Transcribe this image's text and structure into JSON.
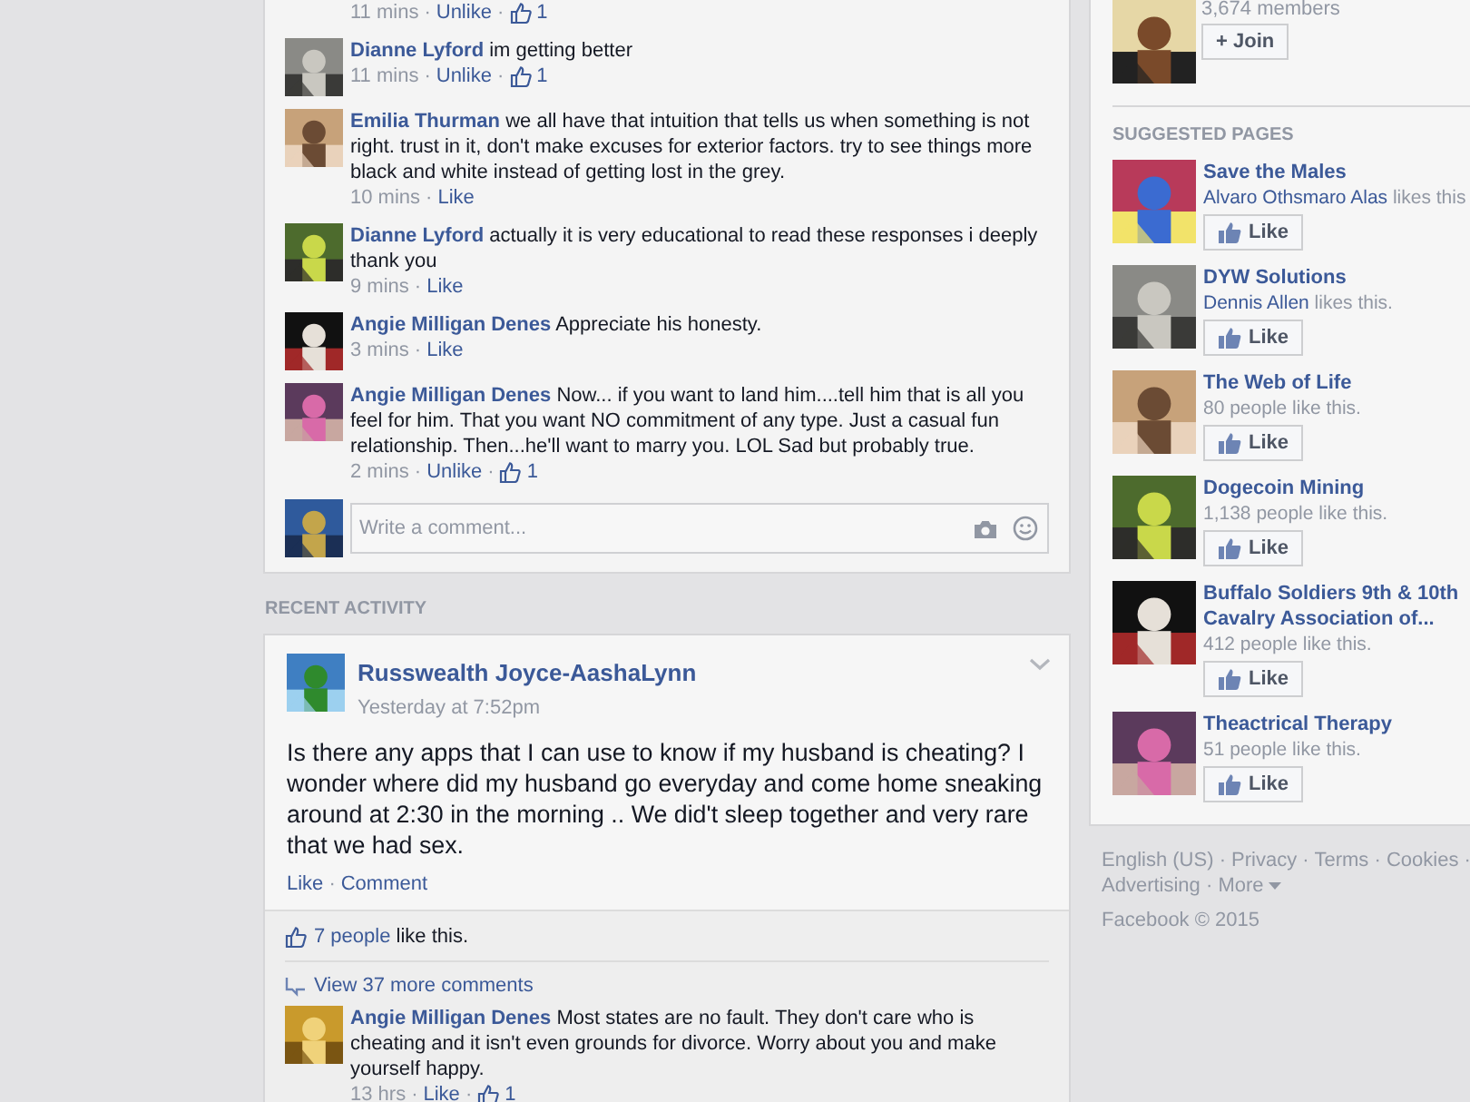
{
  "comment_thread": {
    "cut_meta": {
      "time": "11 mins",
      "action": "Unlike",
      "likes": "1"
    },
    "comments": [
      {
        "author": "Dianne Lyford",
        "text": "im getting better",
        "time": "11 mins",
        "action": "Unlike",
        "likes": "1"
      },
      {
        "author": "Emilia Thurman",
        "text": "we all have that intuition that tells us when something is not right. trust in it, don't make excuses for exterior factors. try to see things more black and white instead of getting lost in the grey.",
        "time": "10 mins",
        "action": "Like"
      },
      {
        "author": "Dianne Lyford",
        "text": "actually it is very educational to read these responses i deeply thank you",
        "time": "9 mins",
        "action": "Like"
      },
      {
        "author": "Angie Milligan Denes",
        "text": "Appreciate his honesty.",
        "time": "3 mins",
        "action": "Like"
      },
      {
        "author": "Angie Milligan Denes",
        "text": "Now... if you want to land him....tell him that is all you feel for him. That you want NO commitment of any type. Just a casual fun relationship. Then...he'll want to marry you. LOL Sad but probably true.",
        "time": "2 mins",
        "action": "Unlike",
        "likes": "1"
      }
    ],
    "composer": {
      "placeholder": "Write a comment..."
    }
  },
  "section_title": "RECENT ACTIVITY",
  "post": {
    "author": "Russwealth Joyce-AashaLynn",
    "time": "Yesterday at 7:52pm",
    "text": "Is there any apps that I can use to know if my husband is cheating? I wonder where did my husband go everyday and come home sneaking around at 2:30 in the morning .. We did't sleep together and very rare that we had sex.",
    "actions": [
      "Like",
      "Comment"
    ],
    "likes": {
      "link": "7 people",
      "rest": "like this."
    },
    "view_more": "View 37 more comments",
    "comments": [
      {
        "author": "Angie Milligan Denes",
        "text": "Most states are no fault. They don't care who is cheating and it isn't even grounds for divorce. Worry about you and make yourself happy.",
        "time": "13 hrs",
        "action": "Like",
        "likes": "1"
      }
    ]
  },
  "sidebar": {
    "group": {
      "members": "3,674 members",
      "join": "+ Join"
    },
    "suggested_title": "SUGGESTED PAGES",
    "pages": [
      {
        "name": "Save the Males",
        "liker": "Alvaro Othsmaro Alas",
        "rest": "likes this",
        "button": "Like"
      },
      {
        "name": "DYW Solutions",
        "liker": "Dennis Allen",
        "rest": "likes this.",
        "button": "Like"
      },
      {
        "name": "The Web of Life",
        "rest": "80 people like this.",
        "button": "Like"
      },
      {
        "name": "Dogecoin Mining",
        "rest": "1,138 people like this.",
        "button": "Like"
      },
      {
        "name": "Buffalo Soldiers 9th & 10th Cavalry Association of...",
        "rest": "412 people like this.",
        "button": "Like"
      },
      {
        "name": "Theactrical Therapy",
        "rest": "51 people like this.",
        "button": "Like"
      }
    ]
  },
  "separator": "·",
  "footer": {
    "links": [
      "English (US)",
      "Privacy",
      "Terms",
      "Cookies",
      "Advertising",
      "More"
    ],
    "copyright": "Facebook © 2015"
  }
}
